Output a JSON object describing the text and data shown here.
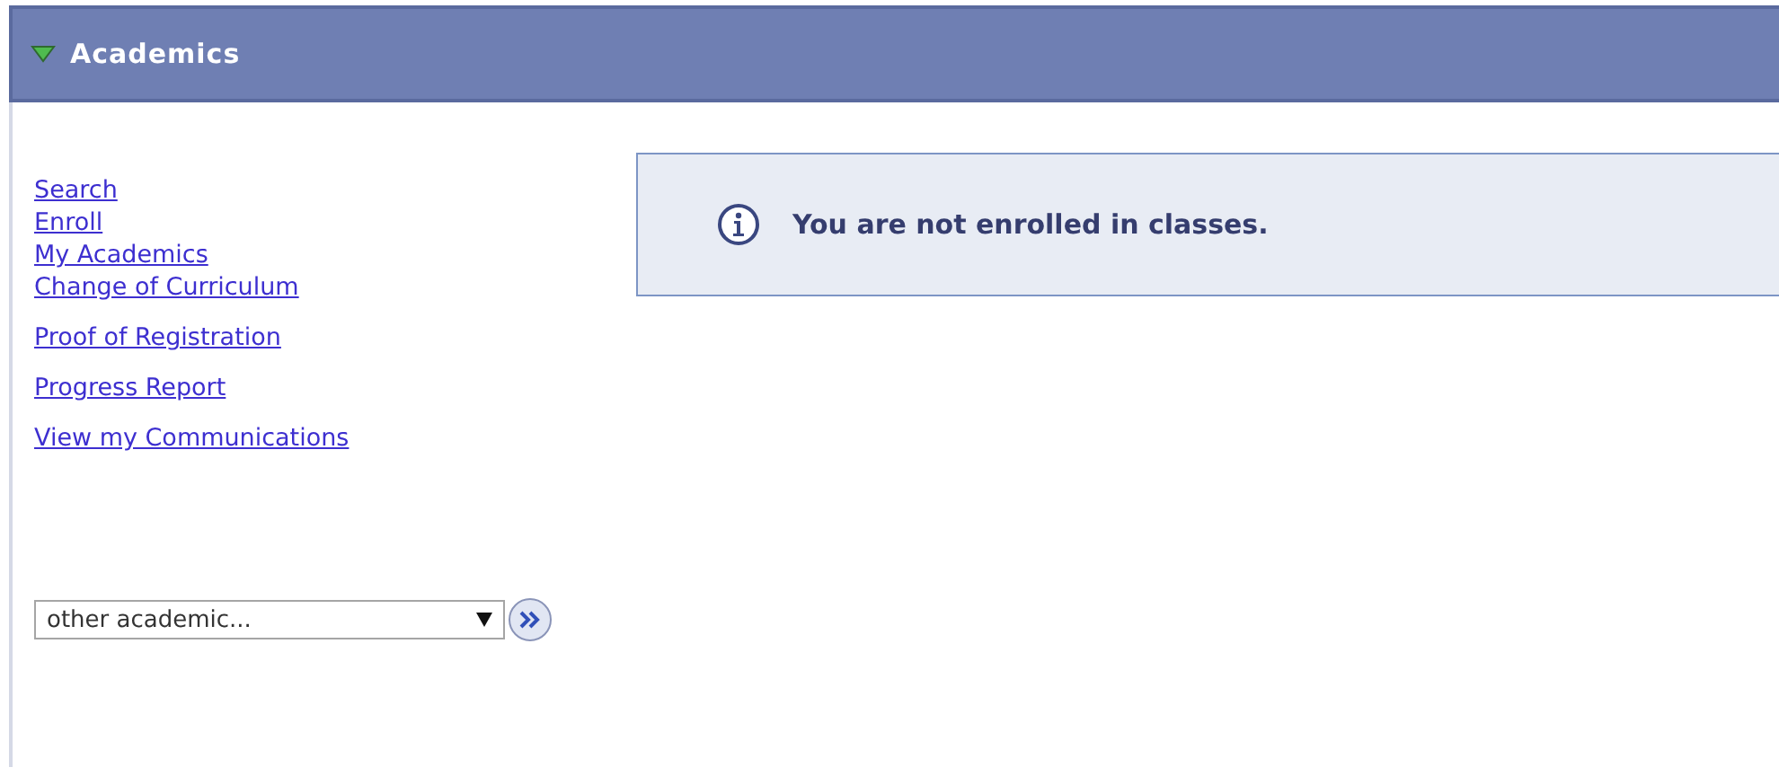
{
  "section": {
    "title": "Academics",
    "expanded": true
  },
  "primary_links": [
    "Search",
    "Enroll",
    "My Academics",
    "Change of Curriculum"
  ],
  "secondary_links": [
    "Proof of Registration",
    "Progress Report",
    "View my Communications"
  ],
  "dropdown": {
    "value": "other academic..."
  },
  "message": {
    "text": "You are not enrolled in classes."
  }
}
